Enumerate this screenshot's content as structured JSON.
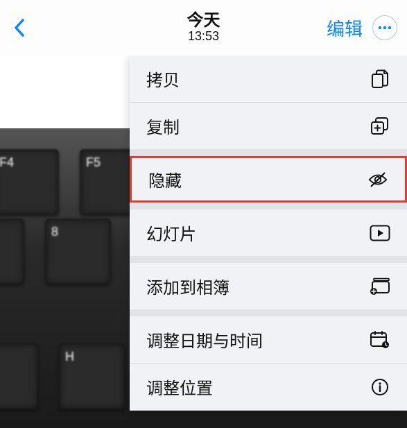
{
  "header": {
    "title": "今天",
    "time": "13:53",
    "edit_label": "编辑"
  },
  "menu": {
    "copy_label": "拷贝",
    "duplicate_label": "复制",
    "hide_label": "隐藏",
    "slideshow_label": "幻灯片",
    "addalbum_label": "添加到相簿",
    "adjust_datetime_label": "调整日期与时间",
    "adjust_location_label": "调整位置"
  }
}
